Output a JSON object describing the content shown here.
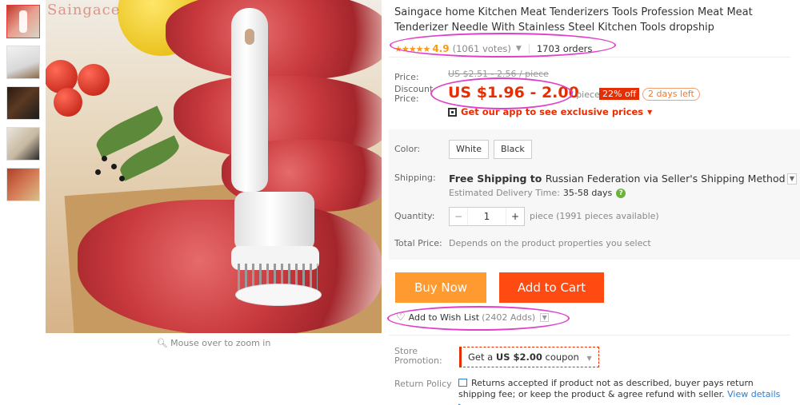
{
  "brand_watermark": "Saingace",
  "gallery": {
    "zoom_hint": "Mouse over to zoom in"
  },
  "product": {
    "title": "Saingace home Kitchen Meat Tenderizers Tools Profession Meat Meat Tenderizer Needle With Stainless Steel Kitchen Tools dropship",
    "stars": "★★★★★",
    "rating": "4.9",
    "votes": "(1061 votes)",
    "orders": "1703 orders"
  },
  "price": {
    "label": "Price:",
    "original": "US $2.51 - 2.56 / piece",
    "discount_label": "Discount Price:",
    "discount": "US $1.96 - 2.00",
    "unit": "/ piece",
    "off_badge": "22% off",
    "days_left": "2 days left",
    "app_promo": "Get our app to see exclusive prices"
  },
  "options": {
    "color_label": "Color:",
    "colors": [
      "White",
      "Black"
    ],
    "shipping_label": "Shipping:",
    "shipping_main": "Free Shipping to",
    "shipping_rest": "Russian Federation via Seller's Shipping Method",
    "delivery_label": "Estimated Delivery Time:",
    "delivery_value": "35-58 days",
    "quantity_label": "Quantity:",
    "quantity_value": "1",
    "quantity_info": "piece (1991 pieces available)",
    "total_label": "Total Price:",
    "total_info": "Depends on the product properties you select"
  },
  "actions": {
    "buy_now": "Buy Now",
    "add_to_cart": "Add to Cart",
    "wish_list": "Add to Wish List",
    "wish_count": "(2402 Adds)"
  },
  "store": {
    "promo_label": "Store Promotion:",
    "coupon_prefix": "Get a",
    "coupon_amount": "US $2.00",
    "coupon_suffix": "coupon",
    "return_label": "Return Policy",
    "return_text": "Returns accepted if product not as described, buyer pays return shipping fee; or keep the product & agree refund with seller.",
    "view_details": "View details ▸"
  },
  "annotation_color": "#e040c8"
}
